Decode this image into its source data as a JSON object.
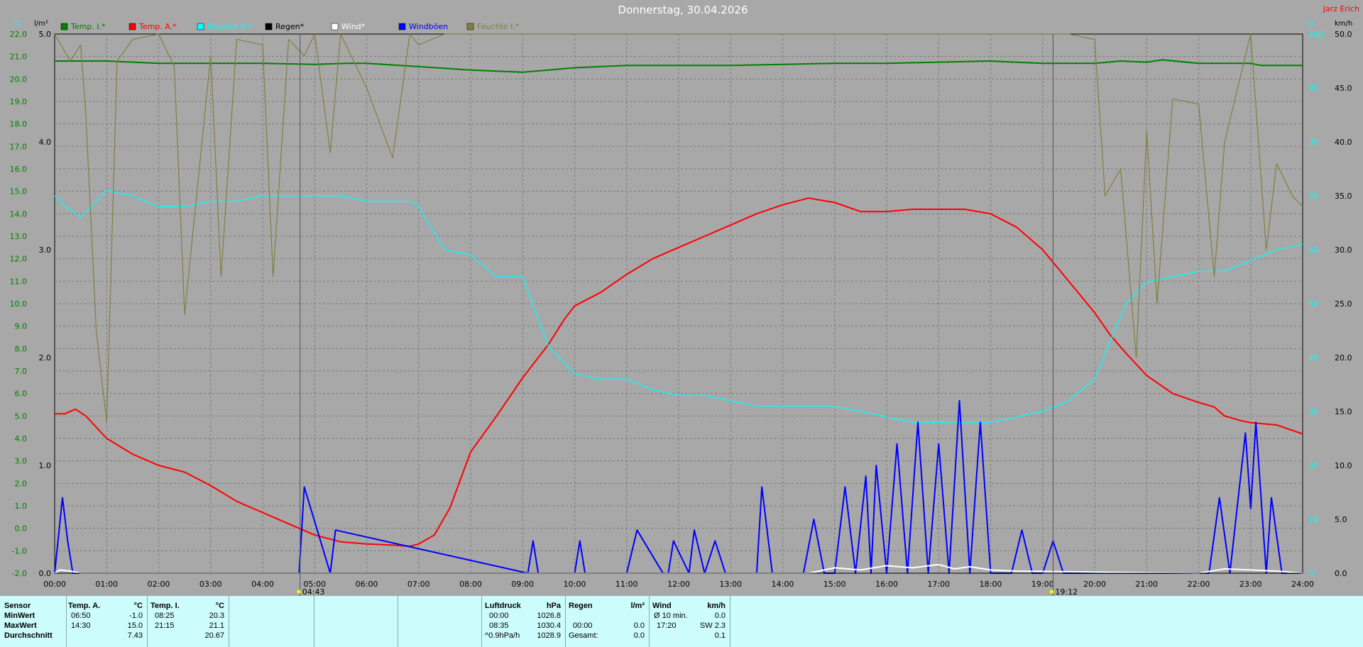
{
  "header": {
    "title": "Donnerstag, 30.04.2026",
    "author": "Jarz Erich"
  },
  "units": {
    "temp": "°C",
    "rain": "l/m²",
    "humidity": "%",
    "wind": "km/h"
  },
  "legend": [
    {
      "label": "Temp. I.*",
      "color": "#008000"
    },
    {
      "label": "Temp. A.*",
      "color": "#ff0000"
    },
    {
      "label": "Feuchte A.*",
      "color": "#00ffff"
    },
    {
      "label": "Regen*",
      "color": "#000000"
    },
    {
      "label": "Wind*",
      "color": "#ffffff"
    },
    {
      "label": "Windböen",
      "color": "#0000ff"
    },
    {
      "label": "Feuchte I.*",
      "color": "#808040"
    }
  ],
  "chart_data": {
    "type": "line",
    "title": "Donnerstag, 30.04.2026",
    "x_unit": "hours",
    "xlim": [
      0,
      24
    ],
    "x_ticks": [
      "00:00",
      "01:00",
      "02:00",
      "03:00",
      "04:00",
      "05:00",
      "06:00",
      "07:00",
      "08:00",
      "09:00",
      "10:00",
      "11:00",
      "12:00",
      "13:00",
      "14:00",
      "15:00",
      "16:00",
      "17:00",
      "18:00",
      "19:00",
      "20:00",
      "21:00",
      "22:00",
      "23:00",
      "24:00"
    ],
    "temp_axis": {
      "min": -2,
      "max": 22,
      "step": 1,
      "ticks": [
        "22.0",
        "21.0",
        "20.0",
        "19.0",
        "18.0",
        "17.0",
        "16.0",
        "15.0",
        "14.0",
        "13.0",
        "12.0",
        "11.0",
        "10.0",
        "9.0",
        "8.0",
        "7.0",
        "6.0",
        "5.0",
        "4.0",
        "3.0",
        "2.0",
        "1.0",
        "0.0",
        "-1.0",
        "-2.0"
      ]
    },
    "rain_axis": {
      "min": 0,
      "max": 5,
      "ticks": [
        "5.0",
        "4.0",
        "3.0",
        "2.0",
        "1.0",
        "0.0"
      ]
    },
    "humidity_axis": {
      "min": 0,
      "max": 100,
      "ticks": [
        "100",
        "90",
        "80",
        "70",
        "60",
        "50",
        "40",
        "30",
        "20",
        "10",
        "0"
      ]
    },
    "wind_axis": {
      "min": 0,
      "max": 50,
      "ticks": [
        "50.0",
        "45.0",
        "40.0",
        "35.0",
        "30.0",
        "25.0",
        "20.0",
        "15.0",
        "10.0",
        "5.0",
        "0.0"
      ]
    },
    "grid": true,
    "events": [
      {
        "x": 4.72,
        "label": "04:43"
      },
      {
        "x": 19.2,
        "label": "19:12"
      }
    ],
    "series": [
      {
        "name": "Temp. I.*",
        "color": "#008000",
        "axis": "temp",
        "x": [
          0,
          1,
          2,
          3,
          4,
          5,
          5.6,
          6,
          7,
          8,
          9,
          10,
          11,
          12,
          13,
          14,
          15,
          16,
          17,
          18,
          19,
          20,
          20.5,
          21,
          21.3,
          22,
          23,
          23.2,
          24
        ],
        "y": [
          20.8,
          20.8,
          20.7,
          20.7,
          20.7,
          20.65,
          20.7,
          20.7,
          20.55,
          20.4,
          20.3,
          20.5,
          20.6,
          20.6,
          20.6,
          20.65,
          20.7,
          20.7,
          20.75,
          20.8,
          20.7,
          20.7,
          20.8,
          20.75,
          20.85,
          20.7,
          20.7,
          20.6,
          20.6
        ]
      },
      {
        "name": "Temp. A.*",
        "color": "#ff0000",
        "axis": "temp",
        "x": [
          0,
          0.2,
          0.4,
          0.6,
          0.8,
          1,
          1.5,
          2,
          2.5,
          3,
          3.5,
          4,
          4.5,
          5,
          5.5,
          6,
          6.5,
          6.83,
          7,
          7.3,
          7.6,
          8,
          8.5,
          9,
          9.5,
          9.8,
          10,
          10.5,
          11,
          11.5,
          12,
          12.5,
          13,
          13.5,
          14,
          14.5,
          15,
          15.5,
          16,
          16.5,
          17,
          17.5,
          18,
          18.5,
          19,
          19.5,
          20,
          20.3,
          20.6,
          21,
          21.5,
          22,
          22.3,
          22.5,
          22.8,
          23,
          23.5,
          24
        ],
        "y": [
          5.1,
          5.1,
          5.3,
          5.0,
          4.5,
          4.0,
          3.3,
          2.8,
          2.5,
          1.9,
          1.2,
          0.7,
          0.2,
          -0.3,
          -0.6,
          -0.7,
          -0.75,
          -0.8,
          -0.7,
          -0.3,
          0.9,
          3.4,
          5.0,
          6.7,
          8.2,
          9.3,
          9.9,
          10.5,
          11.3,
          12.0,
          12.5,
          13.0,
          13.5,
          14.0,
          14.4,
          14.7,
          14.5,
          14.1,
          14.1,
          14.2,
          14.2,
          14.2,
          14.0,
          13.4,
          12.4,
          11.0,
          9.6,
          8.6,
          7.8,
          6.8,
          6.0,
          5.6,
          5.4,
          5.0,
          4.8,
          4.7,
          4.6,
          4.2
        ]
      },
      {
        "name": "Feuchte A.*",
        "color": "#00ffff",
        "axis": "humidity",
        "x": [
          0,
          0.2,
          0.5,
          1,
          1.5,
          2,
          2.5,
          3,
          3.5,
          4,
          4.5,
          5,
          5.5,
          6,
          6.5,
          6.83,
          7,
          7.5,
          8,
          8.5,
          9,
          9.5,
          10,
          10.5,
          11,
          11.5,
          12,
          12.5,
          13,
          13.5,
          14,
          14.5,
          15,
          15.5,
          16,
          16.5,
          17,
          17.5,
          18,
          18.5,
          19,
          19.5,
          20,
          20.3,
          20.6,
          21,
          21.5,
          22,
          22.5,
          23,
          23.5,
          24
        ],
        "y": [
          70,
          68,
          66,
          71,
          70,
          68,
          68,
          69,
          69,
          70,
          70,
          70,
          70,
          69,
          69,
          69,
          68,
          60,
          59,
          55,
          55,
          42,
          37,
          36,
          36,
          34,
          33,
          33,
          32,
          31,
          31,
          31,
          31,
          30,
          29,
          28,
          28,
          28,
          28,
          29,
          30,
          32,
          36,
          43,
          50,
          54,
          55,
          56,
          56,
          58,
          60,
          61
        ]
      },
      {
        "name": "Feuchte I.*",
        "color": "#808040",
        "axis": "humidity",
        "x": [
          0,
          0.3,
          0.5,
          0.6,
          0.8,
          1,
          1.2,
          1.5,
          2,
          2.3,
          2.5,
          3,
          3.2,
          3.5,
          4,
          4.2,
          4.5,
          4.8,
          5,
          5.3,
          5.5,
          6,
          6.5,
          6.83,
          7,
          7.5,
          8,
          9,
          10,
          11,
          12,
          13,
          14,
          15,
          16,
          17,
          18,
          19,
          19.5,
          20,
          20.2,
          20.5,
          20.8,
          21,
          21.2,
          21.5,
          22,
          22.3,
          22.5,
          23,
          23.3,
          23.5,
          23.8,
          24
        ],
        "y": [
          100,
          95,
          98,
          85,
          45,
          28,
          95,
          99,
          100,
          94,
          48,
          96,
          55,
          99,
          98,
          55,
          99,
          96,
          100,
          78,
          100,
          90,
          77,
          100,
          98,
          100,
          100,
          100,
          100,
          100,
          100,
          100,
          100,
          100,
          100,
          100,
          100,
          100,
          100,
          99,
          70,
          75,
          40,
          82,
          50,
          88,
          87,
          55,
          80,
          100,
          60,
          76,
          70,
          68
        ]
      },
      {
        "name": "Windböen",
        "color": "#0000ff",
        "axis": "wind",
        "x": [
          0,
          0.15,
          0.25,
          0.35,
          0.45,
          3.6,
          3.7,
          4.7,
          4.8,
          5.3,
          5.4,
          9.1,
          9.2,
          9.3,
          10.0,
          10.1,
          10.2,
          10.4,
          10.6,
          11.0,
          11.2,
          11.7,
          11.8,
          11.9,
          12.2,
          12.3,
          12.5,
          12.7,
          12.9,
          13.2,
          13.5,
          13.6,
          13.8,
          14.0,
          14.4,
          14.6,
          14.8,
          15.0,
          15.2,
          15.4,
          15.6,
          15.7,
          15.8,
          16.0,
          16.2,
          16.4,
          16.6,
          16.8,
          17.0,
          17.2,
          17.4,
          17.6,
          17.8,
          18.0,
          18.4,
          18.6,
          18.8,
          19.0,
          19.2,
          19.4,
          22.2,
          22.4,
          22.6,
          22.9,
          23.0,
          23.1,
          23.3,
          23.4,
          23.6,
          23.8,
          24
        ],
        "y": [
          0,
          7,
          3,
          0,
          0,
          0,
          0,
          0,
          8,
          0,
          4,
          0,
          3,
          0,
          0,
          3,
          0,
          0,
          0,
          0,
          4,
          0,
          0,
          3,
          0,
          4,
          0,
          3,
          0,
          0,
          0,
          8,
          0,
          0,
          0,
          5,
          0,
          0,
          8,
          0,
          9,
          0,
          10,
          0,
          12,
          0,
          14,
          0,
          12,
          0,
          16,
          0,
          14,
          0,
          0,
          4,
          0,
          0,
          3,
          0,
          0,
          7,
          0,
          13,
          6,
          14,
          0,
          7,
          0,
          0,
          0
        ]
      },
      {
        "name": "Wind*",
        "color": "#ffffff",
        "axis": "wind",
        "x": [
          0,
          0.1,
          0.3,
          0.5,
          14.5,
          15,
          15.5,
          16,
          16.5,
          17,
          17.3,
          17.6,
          18,
          18.5,
          22,
          22.5,
          23,
          23.5,
          24
        ],
        "y": [
          0,
          0.3,
          0.2,
          0,
          0,
          0.5,
          0.3,
          0.7,
          0.5,
          0.8,
          0.4,
          0.6,
          0.3,
          0.2,
          0,
          0.4,
          0.3,
          0.2,
          0
        ]
      },
      {
        "name": "Regen*",
        "color": "#000000",
        "axis": "rain",
        "x": [
          0,
          24
        ],
        "y": [
          0,
          0
        ]
      }
    ]
  },
  "stats": {
    "sensor_col": {
      "title": "Sensor",
      "rows": [
        "MinWert",
        "MaxWert",
        "Durchschnitt"
      ]
    },
    "temp_a": {
      "title": "Temp. A.",
      "unit": "°C",
      "min_time": "06:50",
      "min_val": "-1.0",
      "max_time": "14:30",
      "max_val": "15.0",
      "avg": "7.43"
    },
    "temp_i": {
      "title": "Temp. I.",
      "unit": "°C",
      "min_time": "08:25",
      "min_val": "20.3",
      "max_time": "21:15",
      "max_val": "21.1",
      "avg": "20.67"
    },
    "pressure": {
      "title": "Luftdruck",
      "unit": "hPa",
      "min_time": "00:00",
      "min_val": "1026.8",
      "max_time": "08:35",
      "max_val": "1030.4",
      "trend_label": "^0.9hPa/h",
      "trend_val": "1028.9"
    },
    "rain": {
      "title": "Regen",
      "unit": "l/m²",
      "max_time": "00:00",
      "max_val": "0.0",
      "total_label": "Gesamt:",
      "total_val": "0.0"
    },
    "wind": {
      "title": "Wind",
      "unit": "km/h",
      "min_time": "Ø 10 min.",
      "min_val": "0.0",
      "max_time": "17:20",
      "max_val": "SW 2.3",
      "avg": "0.1"
    }
  }
}
